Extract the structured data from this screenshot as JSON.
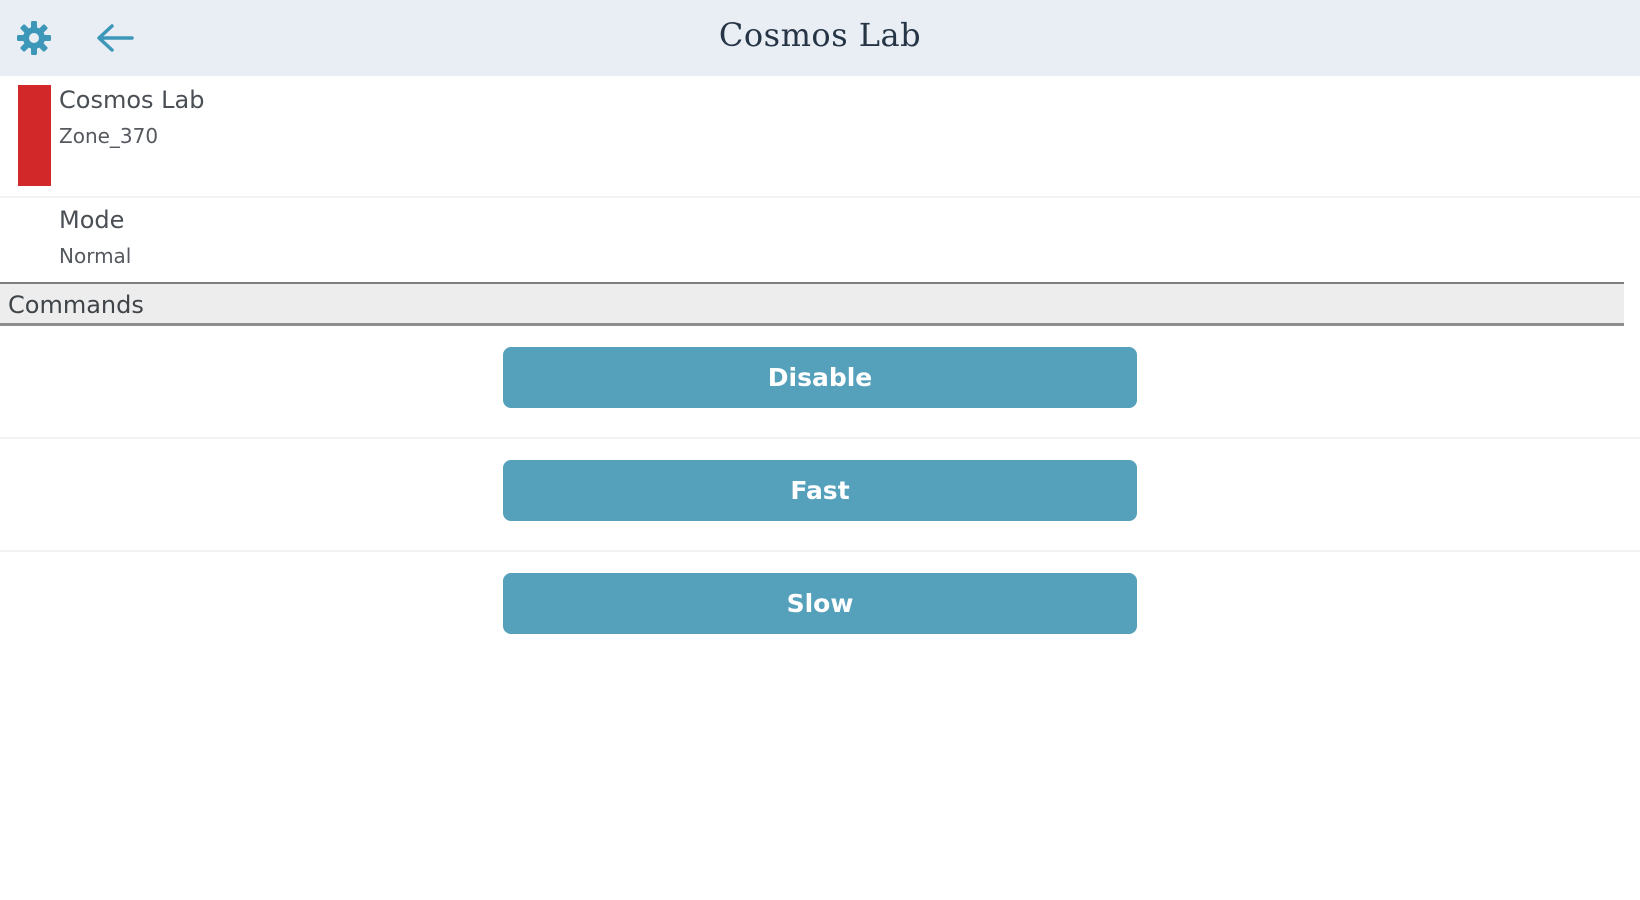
{
  "header": {
    "title": "Cosmos Lab",
    "settings_icon": "gear-icon",
    "back_icon": "arrow-left-icon",
    "icon_color": "#3d97b8"
  },
  "device": {
    "name": "Cosmos Lab",
    "zone": "Zone_370",
    "status_color": "#d2282a"
  },
  "mode": {
    "label": "Mode",
    "value": "Normal"
  },
  "commands": {
    "section_label": "Commands",
    "button_color": "#55a0bb",
    "buttons": [
      {
        "label": "Disable"
      },
      {
        "label": "Fast"
      },
      {
        "label": "Slow"
      }
    ]
  }
}
